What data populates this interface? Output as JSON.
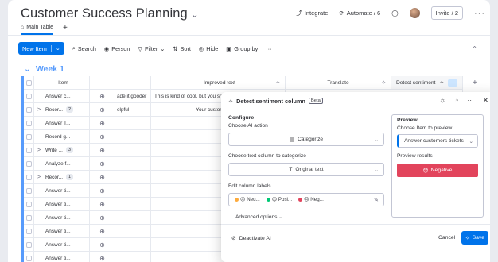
{
  "header": {
    "title": "Customer Success Planning",
    "integrate": "Integrate",
    "automate": "Automate / 6",
    "invite": "Invite / 2"
  },
  "tabs": {
    "main": "Main Table",
    "add": "+"
  },
  "toolbar": {
    "new_item": "New Item",
    "search": "Search",
    "person": "Person",
    "filter": "Filter",
    "sort": "Sort",
    "hide": "Hide",
    "group_by": "Group by"
  },
  "group": {
    "title": "Week 1"
  },
  "table": {
    "columns": {
      "item": "Item",
      "improved": "Improved text",
      "translate": "Translate",
      "detect": "Detect sentiment"
    },
    "rows": [
      {
        "item": "Answer c...",
        "expand": "",
        "badge": "",
        "gooder": "ade it gooder",
        "improved": "This is kind of cool, but you sh"
      },
      {
        "item": "Recor...",
        "expand": ">",
        "badge": "2",
        "gooder": "elpful",
        "improved": "Your customer servic"
      },
      {
        "item": "Answer T...",
        "expand": "",
        "badge": "",
        "gooder": "",
        "improved": ""
      },
      {
        "item": "Record g...",
        "expand": "",
        "badge": "",
        "gooder": "",
        "improved": ""
      },
      {
        "item": "Write ...",
        "expand": ">",
        "badge": "3",
        "gooder": "",
        "improved": ""
      },
      {
        "item": "Analyze f...",
        "expand": "",
        "badge": "",
        "gooder": "",
        "improved": ""
      },
      {
        "item": "Recor...",
        "expand": ">",
        "badge": "1",
        "gooder": "",
        "improved": ""
      },
      {
        "item": "Answer ti...",
        "expand": "",
        "badge": "",
        "gooder": "",
        "improved": ""
      },
      {
        "item": "Answer ti...",
        "expand": "",
        "badge": "",
        "gooder": "",
        "improved": ""
      },
      {
        "item": "Answer ti...",
        "expand": "",
        "badge": "",
        "gooder": "",
        "improved": ""
      },
      {
        "item": "Answer ti...",
        "expand": "",
        "badge": "",
        "gooder": "",
        "improved": ""
      },
      {
        "item": "Answer ti...",
        "expand": "",
        "badge": "",
        "gooder": "",
        "improved": ""
      },
      {
        "item": "Answer ti...",
        "expand": "",
        "badge": "",
        "gooder": "",
        "improved": ""
      }
    ]
  },
  "panel": {
    "title": "Detect sentiment column",
    "beta": "Beta",
    "configure": "Configure",
    "choose_action_label": "Choose AI action",
    "action_value": "Categorize",
    "choose_text_label": "Choose text column to categorize",
    "text_value": "Original text",
    "edit_labels_label": "Edit column labels",
    "labels": [
      {
        "text": "Neu...",
        "color": "#fdab3d"
      },
      {
        "text": "Posi...",
        "color": "#00c875"
      },
      {
        "text": "Neg...",
        "color": "#e2445c"
      }
    ],
    "advanced": "Advanced options",
    "preview": "Preview",
    "choose_item_label": "Choose Item to preview",
    "preview_item": "Answer customers tickets",
    "preview_results": "Preview results",
    "result": "Negative",
    "deactivate": "Deactivate AI",
    "cancel": "Cancel",
    "save": "Save"
  }
}
